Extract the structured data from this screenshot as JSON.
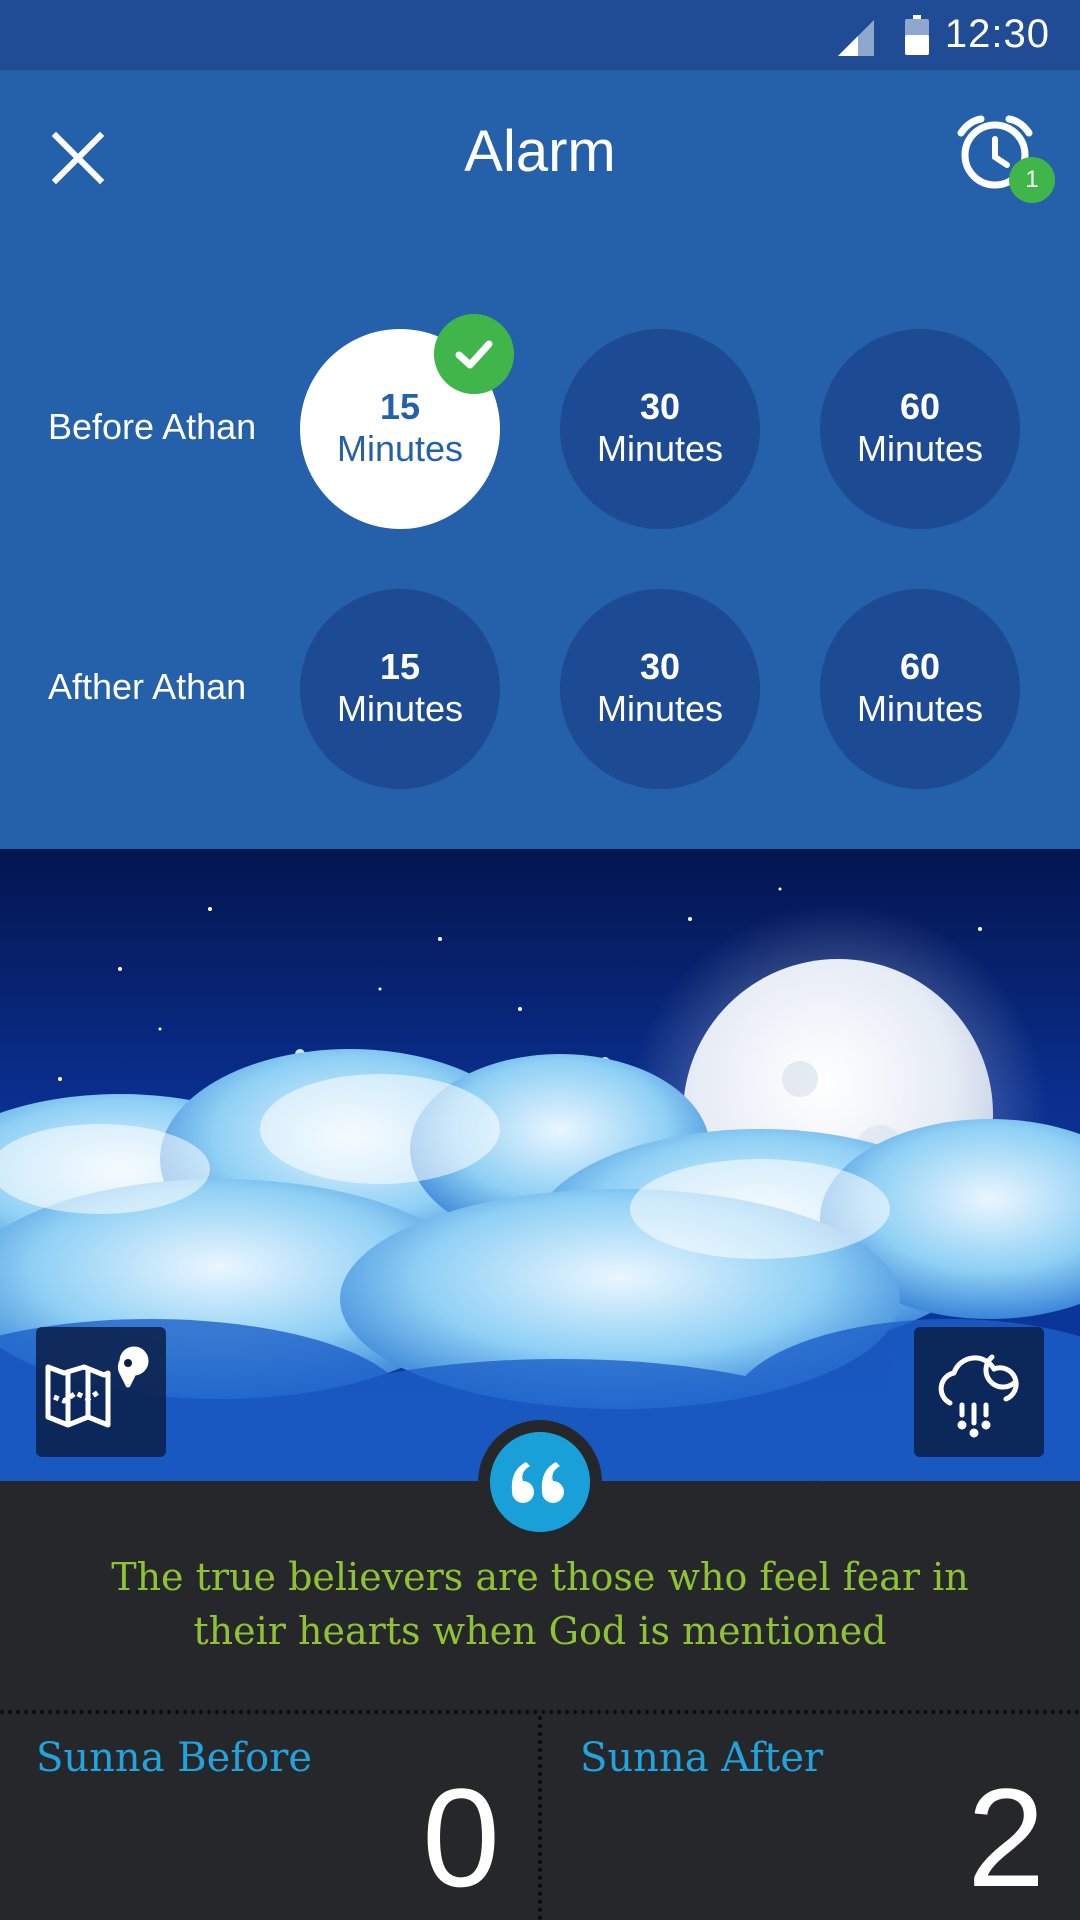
{
  "status_bar": {
    "time": "12:30",
    "signal_icon": "cell-signal-icon",
    "battery_icon": "battery-icon"
  },
  "header": {
    "title": "Alarm",
    "close_icon": "close-icon",
    "alarm_icon": "alarm-clock-icon",
    "alarm_badge_count": "1"
  },
  "alarm_options": {
    "before": {
      "label": "Before Athan",
      "options": [
        {
          "value": "15",
          "unit": "Minutes",
          "selected": true
        },
        {
          "value": "30",
          "unit": "Minutes",
          "selected": false
        },
        {
          "value": "60",
          "unit": "Minutes",
          "selected": false
        }
      ]
    },
    "after": {
      "label": "Afther Athan",
      "options": [
        {
          "value": "15",
          "unit": "Minutes",
          "selected": false
        },
        {
          "value": "30",
          "unit": "Minutes",
          "selected": false
        },
        {
          "value": "60",
          "unit": "Minutes",
          "selected": false
        }
      ]
    }
  },
  "sky": {
    "map_icon": "map-location-icon",
    "weather_icon": "weather-night-rain-icon"
  },
  "quote": {
    "icon": "quote-icon",
    "text": "The true believers are those who feel fear in their hearts when God is mentioned"
  },
  "sunna": {
    "before_label": "Sunna Before",
    "before_value": "0",
    "after_label": "Sunna After",
    "after_value": "2"
  },
  "colors": {
    "primary": "#2561ab",
    "status_bar": "#1f4c94",
    "option_circle": "#1c4a93",
    "success_green": "#3fb54a",
    "quote_green": "#8fc234",
    "accent_blue": "#1aa0d8",
    "dark_background": "#26272b"
  }
}
